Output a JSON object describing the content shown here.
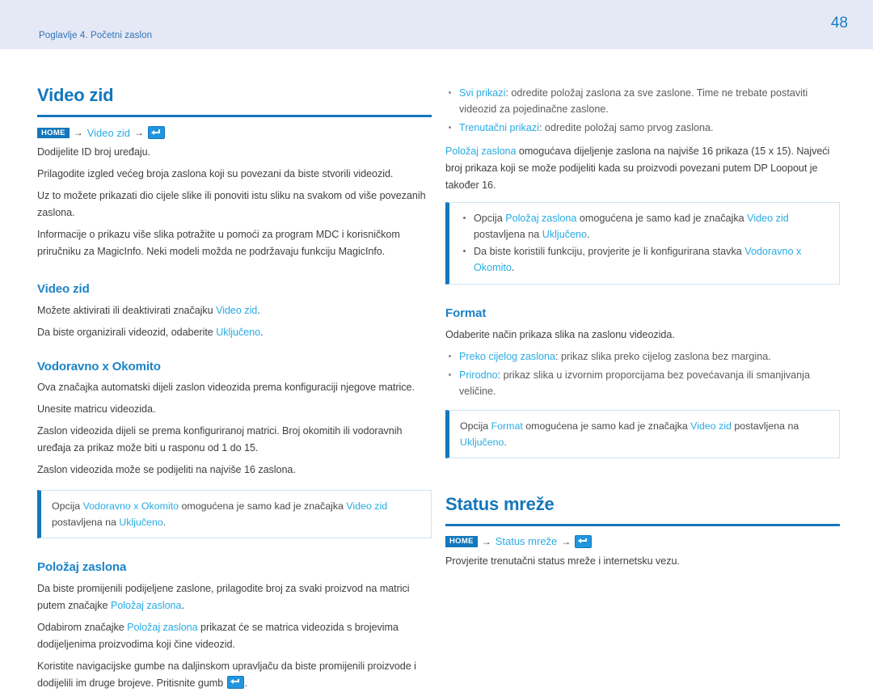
{
  "header": {
    "chapter": "Poglavlje 4. Početni zaslon",
    "page_number": "48"
  },
  "icons": {
    "enter": "enter-key-icon",
    "arrow": "→"
  },
  "colors": {
    "heading": "#1477bc",
    "subheading": "#1b83c6",
    "link": "#29abe2",
    "header_band": "#e5e9f5",
    "body_text": "#3f3f3f"
  },
  "left_column": {
    "title": "Video zid",
    "breadcrumb": {
      "home": "HOME",
      "arrow": "→",
      "link": "Video zid"
    },
    "intro": [
      "Dodijelite ID broj uređaju.",
      "Prilagodite izgled većeg broja zaslona koji su povezani da biste stvorili videozid.",
      "Uz to možete prikazati dio cijele slike ili ponoviti istu sliku na svakom od više povezanih zaslona.",
      "Informacije o prikazu više slika potražite u pomoći za program MDC i korisničkom priručniku za MagicInfo. Neki modeli možda ne podržavaju funkciju MagicInfo."
    ],
    "section_video_zid": {
      "heading": "Video zid",
      "line1_a": "Možete aktivirati ili deaktivirati značajku ",
      "line1_link": "Video zid",
      "line1_b": ".",
      "line2_a": "Da biste organizirali videozid, odaberite ",
      "line2_link": "Uključeno",
      "line2_b": "."
    },
    "section_vodoravno": {
      "heading": "Vodoravno x Okomito",
      "p1": "Ova značajka automatski dijeli zaslon videozida prema konfiguraciji njegove matrice.",
      "p2": "Unesite matricu videozida.",
      "p3": "Zaslon videozida dijeli se prema konfiguriranoj matrici. Broj okomitih ili vodoravnih uređaja za prikaz može biti u rasponu od 1 do 15.",
      "p4": "Zaslon videozida može se podijeliti na najviše 16 zaslona.",
      "note": {
        "a": "Opcija ",
        "link1": "Vodoravno x Okomito",
        "b": " omogućena je samo kad je značajka ",
        "link2": "Video zid",
        "c": " postavljena na ",
        "link3": "Uključeno",
        "d": "."
      }
    },
    "section_polozaj": {
      "heading": "Položaj zaslona",
      "p1_a": "Da biste promijenili podijeljene zaslone, prilagodite broj za svaki proizvod na matrici putem značajke ",
      "p1_link": "Položaj zaslona",
      "p1_b": ".",
      "p2_a": "Odabirom značajke ",
      "p2_link": "Položaj zaslona",
      "p2_b": " prikazat će se matrica videozida s brojevima dodijeljenima proizvodima koji čine videozid.",
      "p3_a": "Koristite navigacijske gumbe na daljinskom upravljaču da biste promijenili proizvode i dodijelili im druge brojeve. Pritisnite gumb ",
      "p3_b": "."
    }
  },
  "right_column": {
    "bullets_top": [
      {
        "link": "Svi prikazi",
        "text": ": odredite položaj zaslona za sve zaslone. Time ne trebate postaviti videozid za pojedinačne zaslone."
      },
      {
        "link": "Trenutačni prikazi",
        "text": ": odredite položaj samo prvog zaslona."
      }
    ],
    "paragraph_polozaj": {
      "link": "Položaj zaslona",
      "text": " omogućava dijeljenje zaslona na najviše 16 prikaza (15 x 15). Najveći broj prikaza koji se može podijeliti kada su proizvodi povezani putem DP Loopout je također 16."
    },
    "note_polozaj": {
      "bullet1": {
        "a": "Opcija ",
        "link1": "Položaj zaslona",
        "b": " omogućena je samo kad je značajka ",
        "link2": "Video zid",
        "c": " postavljena na ",
        "link3": "Uključeno",
        "d": "."
      },
      "bullet2": {
        "a": "Da biste koristili funkciju, provjerite je li konfigurirana stavka ",
        "link1": "Vodoravno x Okomito",
        "b": "."
      }
    },
    "section_format": {
      "heading": "Format",
      "intro": "Odaberite način prikaza slika na zaslonu videozida.",
      "bullets": [
        {
          "link": "Preko cijelog zaslona",
          "text": ": prikaz slika preko cijelog zaslona bez margina."
        },
        {
          "link": "Prirodno",
          "text": ": prikaz slika u izvornim proporcijama bez povećavanja ili smanjivanja veličine."
        }
      ],
      "note": {
        "a": "Opcija ",
        "link1": "Format",
        "b": " omogućena je samo kad je značajka ",
        "link2": "Video zid",
        "c": " postavljena na ",
        "link3": "Uključeno",
        "d": "."
      }
    },
    "section_status": {
      "title": "Status mreže",
      "breadcrumb": {
        "home": "HOME",
        "arrow": "→",
        "link": "Status mreže"
      },
      "paragraph": "Provjerite trenutačni status mreže i internetsku vezu."
    }
  }
}
